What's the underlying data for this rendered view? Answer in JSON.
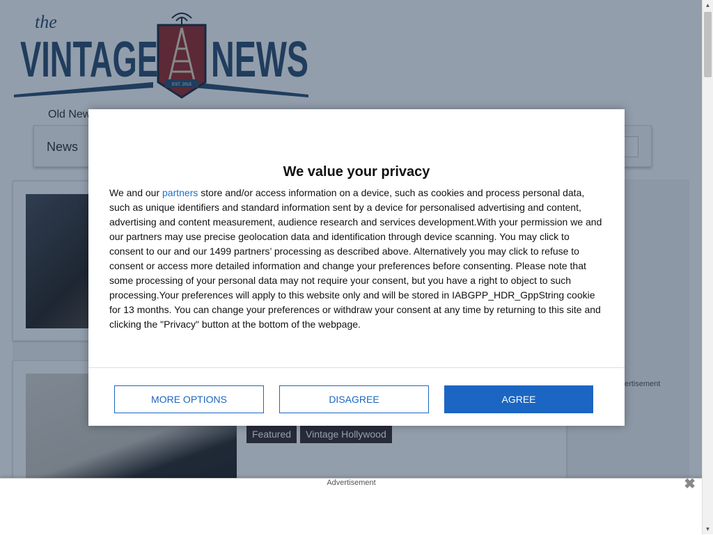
{
  "site": {
    "logo_alt": "the Vintage News",
    "logo_top": "the",
    "logo_left": "VINTAGE",
    "logo_right": "NEWS",
    "logo_badge": "EST. 2015",
    "top_link": "Old News",
    "nav_item": "News"
  },
  "articles": [
    {
      "tags": []
    },
    {
      "tags": [
        "Featured",
        "Vintage Hollywood"
      ]
    }
  ],
  "sidebar": {
    "ad_label": "Advertisement"
  },
  "bottom_ad": {
    "label": "Advertisement",
    "close": "✖"
  },
  "consent": {
    "title": "We value your privacy",
    "text_before_link": "We and our ",
    "link_text": "partners",
    "text_after_link": " store and/or access information on a device, such as cookies and process personal data, such as unique identifiers and standard information sent by a device for personalised advertising and content, advertising and content measurement, audience research and services development.With your permission we and our partners may use precise geolocation data and identification through device scanning. You may click to consent to our and our 1499 partners’ processing as described above. Alternatively you may click to refuse to consent or access more detailed information and change your preferences before consenting. Please note that some processing of your personal data may not require your consent, but you have a right to object to such processing.Your preferences will apply to this website only and will be stored in IABGPP_HDR_GppString cookie for 13 months. You can change your preferences or withdraw your consent at any time by returning to this site and clicking the \"Privacy\" button at the bottom of the webpage.",
    "buttons": {
      "more_options": "MORE OPTIONS",
      "disagree": "DISAGREE",
      "agree": "AGREE"
    }
  },
  "colors": {
    "accent": "#1a66c2",
    "link": "#1a6fcc",
    "tag_bg": "#3b2f2f",
    "logo_blue": "#2f4f6f",
    "logo_red": "#9b2b2b"
  }
}
